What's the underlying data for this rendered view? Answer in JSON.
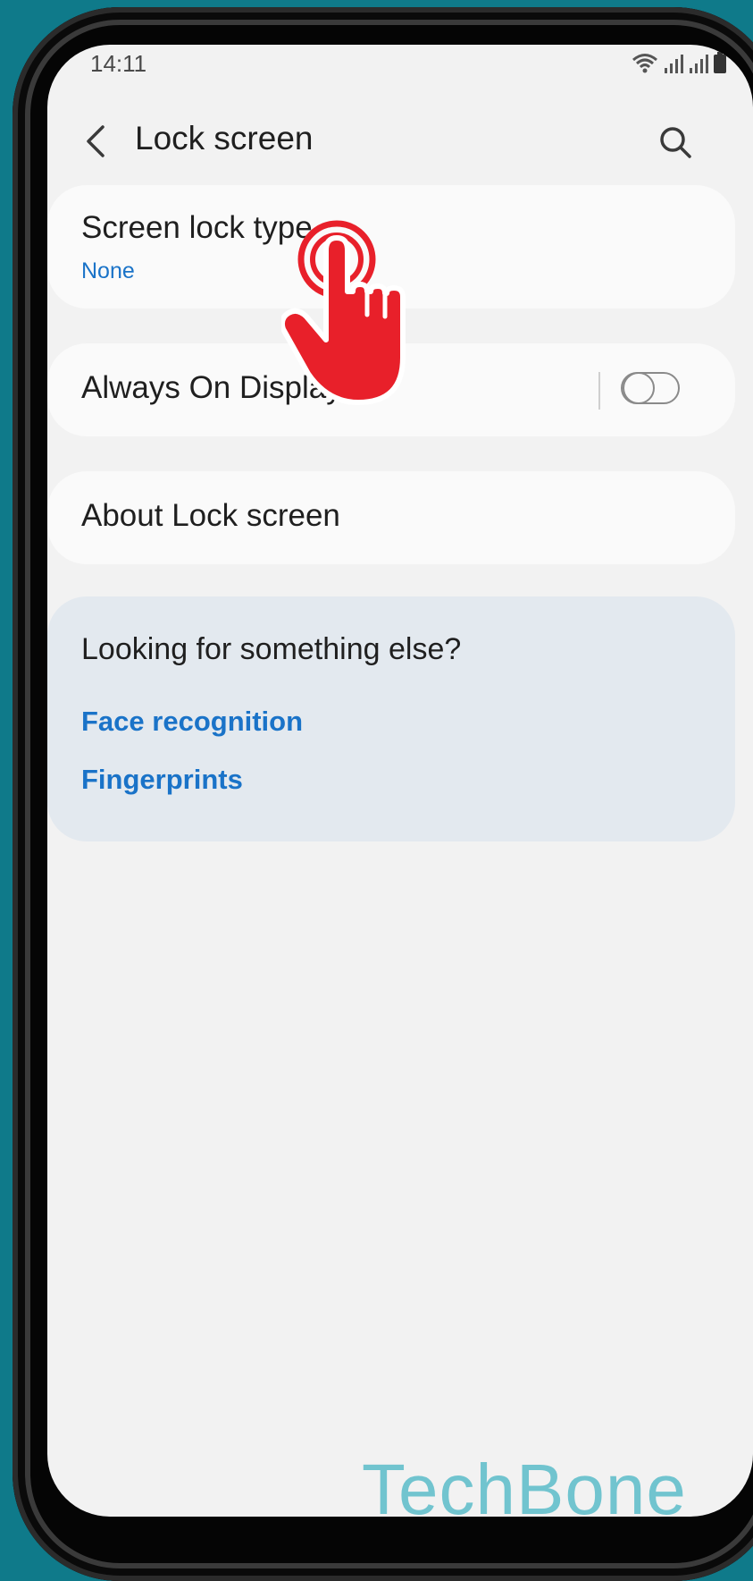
{
  "status_bar": {
    "time": "14:11",
    "icons": [
      "wifi-icon",
      "signal-icon",
      "signal-icon",
      "battery-icon"
    ]
  },
  "header": {
    "title": "Lock screen",
    "back_icon": "chevron-left-icon",
    "search_icon": "search-icon"
  },
  "settings": {
    "screen_lock_type": {
      "title": "Screen lock type",
      "value": "None"
    },
    "always_on_display": {
      "title": "Always On Display",
      "enabled": false
    },
    "about": {
      "title": "About Lock screen"
    }
  },
  "suggestions": {
    "heading": "Looking for something else?",
    "links": [
      "Face recognition",
      "Fingerprints"
    ]
  },
  "overlay": {
    "icon": "tap-hand-icon"
  },
  "watermark": "TechBone",
  "colors": {
    "background": "#0f7a8a",
    "accent": "#1a73c8",
    "tap_indicator": "#e8202a"
  }
}
